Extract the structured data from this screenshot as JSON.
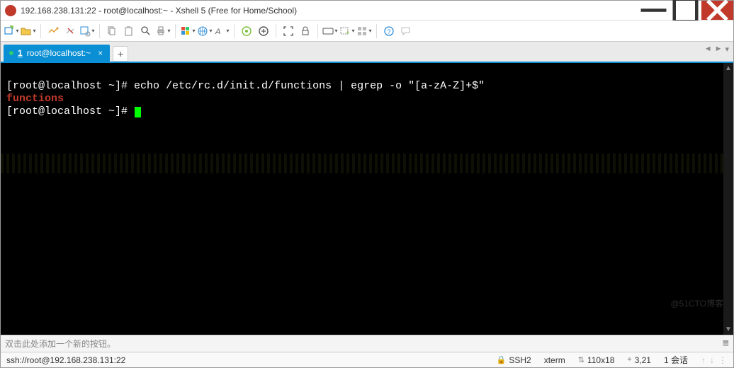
{
  "window": {
    "title": "192.168.238.131:22 - root@localhost:~ - Xshell 5 (Free for Home/School)"
  },
  "tab": {
    "index": "1",
    "label": "root@localhost:~",
    "close": "×"
  },
  "tab_add": "+",
  "terminal": {
    "line1": "[root@localhost ~]# echo /etc/rc.d/init.d/functions | egrep -o \"[a-zA-Z]+$\"",
    "line2": "functions",
    "line3": "[root@localhost ~]# "
  },
  "watermark": "@51CTO博客",
  "hint": "双击此处添加一个新的按钮。",
  "status": {
    "conn": "ssh://root@192.168.238.131:22",
    "proto": "SSH2",
    "termtype": "xterm",
    "size": "110x18",
    "pos": "3,21",
    "sessions": "1 会话"
  },
  "toolbar_icons": {
    "new": "new-session-icon",
    "open": "open-icon",
    "reconnect": "reconnect-icon",
    "disconnect": "disconnect-icon",
    "properties": "properties-icon",
    "copy": "copy-icon",
    "paste": "paste-icon",
    "find": "find-icon",
    "print": "print-icon",
    "color": "color-scheme-icon",
    "globe": "encoding-icon",
    "font": "font-icon",
    "xagent": "xagent-icon",
    "xftp": "xftp-icon",
    "fullscreen": "fullscreen-icon",
    "lock": "lock-icon",
    "keyboard": "keyboard-icon",
    "addbtn": "add-button-icon",
    "tile": "tile-icon",
    "help": "help-icon",
    "feedback": "feedback-icon"
  }
}
